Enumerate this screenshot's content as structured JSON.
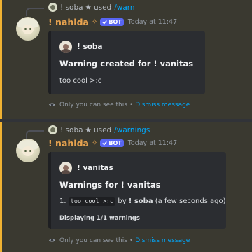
{
  "messages": [
    {
      "reply": {
        "user": "! soba",
        "sparkle": "★",
        "verb": "used",
        "command": "/warn"
      },
      "author": {
        "name": "! nahida",
        "sparkle": "✧",
        "bot_tag": "BOT"
      },
      "timestamp": "Today at 11:47",
      "embed": {
        "author": "! soba",
        "title": "Warning created for ! vanitas",
        "description": "too cool >:c"
      },
      "ephemeral": {
        "text": "Only you can see this",
        "separator": "•",
        "dismiss": "Dismiss message"
      }
    },
    {
      "reply": {
        "user": "! soba",
        "sparkle": "★",
        "verb": "used",
        "command": "/warnings"
      },
      "author": {
        "name": "! nahida",
        "sparkle": "✧",
        "bot_tag": "BOT"
      },
      "timestamp": "Today at 11:47",
      "embed": {
        "author": "! vanitas",
        "title": "Warnings for ! vanitas",
        "line_index": "1.",
        "line_code": "too cool >:c",
        "line_by": "by",
        "line_user": "! soba",
        "line_when": "(a few seconds ago)",
        "footer": "Displaying 1/1 warnings"
      },
      "ephemeral": {
        "text": "Only you can see this",
        "separator": "•",
        "dismiss": "Dismiss message"
      }
    }
  ],
  "colors": {
    "accent": "#f0b232",
    "link": "#00a8fc",
    "username": "#e8a34f",
    "bot": "#5865f2"
  }
}
